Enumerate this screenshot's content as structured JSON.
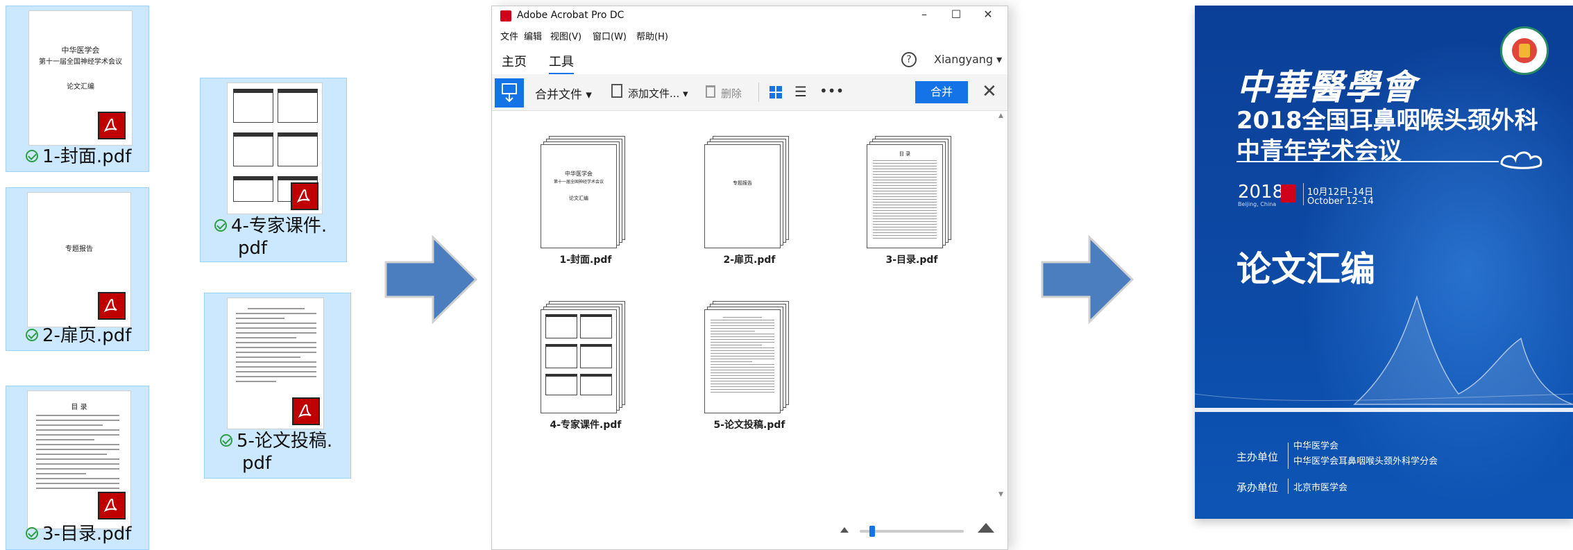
{
  "files": [
    {
      "label": "1-封面.pdf",
      "cover_title": "中华医学会",
      "cover_subtitle": "第十一届全国神经学术会议",
      "cover_heading": "论文汇编"
    },
    {
      "label": "2-扉页.pdf",
      "page_text": "专题报告"
    },
    {
      "label": "3-目录.pdf",
      "page_text": "目 录"
    },
    {
      "label_line1": "4-专家课件.",
      "label_line2": "pdf"
    },
    {
      "label_line1": "5-论文投稿.",
      "label_line2": "pdf"
    }
  ],
  "acrobat": {
    "title": "Adobe Acrobat Pro DC",
    "menu": [
      "文件",
      "编辑",
      "视图(V)",
      "窗口(W)",
      "帮助(H)"
    ],
    "tabs": [
      "主页",
      "工具"
    ],
    "user": "Xiangyang",
    "toolbar": {
      "combine": "合并文件",
      "add": "添加文件...",
      "delete": "删除",
      "merge_button": "合并"
    },
    "docs": [
      {
        "name": "1-封面.pdf",
        "line1": "中华医学会",
        "line2": "第十一届全国神经学术会议",
        "line3": "论文汇编"
      },
      {
        "name": "2-扉页.pdf",
        "line1": "专题报告"
      },
      {
        "name": "3-目录.pdf",
        "line1": "目 录"
      },
      {
        "name": "4-专家课件.pdf"
      },
      {
        "name": "5-论文投稿.pdf"
      }
    ]
  },
  "cover": {
    "calligraphy": "中華醫學會",
    "title_line1": "2018全国耳鼻咽喉头颈外科",
    "title_line2": "中青年学术会议",
    "year": "2018",
    "city": "Beijing, China",
    "date_cn": "10月12日–14日",
    "date_en": "October 12–14",
    "big_title": "论文汇编",
    "host_label": "主办单位",
    "host_1": "中华医学会",
    "host_2": "中华医学会耳鼻咽喉头颈外科学分会",
    "organizer_label": "承办单位",
    "organizer": "北京市医学会"
  },
  "colors": {
    "selection_bg": "#cce8ff",
    "acrobat_blue": "#1473e6",
    "arrow_blue": "#4a7ebf",
    "cover_blue": "#0c4aa6"
  }
}
